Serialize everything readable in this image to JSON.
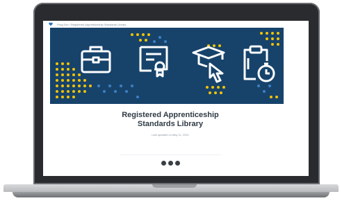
{
  "browser": {
    "breadcrumb": "Prog Dev / Registered Apprenticeship Standards Library"
  },
  "hero": {
    "background_color": "#17436b",
    "accent_color": "#f5c400",
    "icons": [
      "briefcase-icon",
      "certificate-icon",
      "graduation-cap-click-icon",
      "clipboard-timer-icon"
    ]
  },
  "page": {
    "title_line1": "Registered Apprenticeship",
    "title_line2": "Standards Library",
    "subtitle": "Last updated on May 11, 2021"
  },
  "pagination": {
    "dots": 3
  }
}
